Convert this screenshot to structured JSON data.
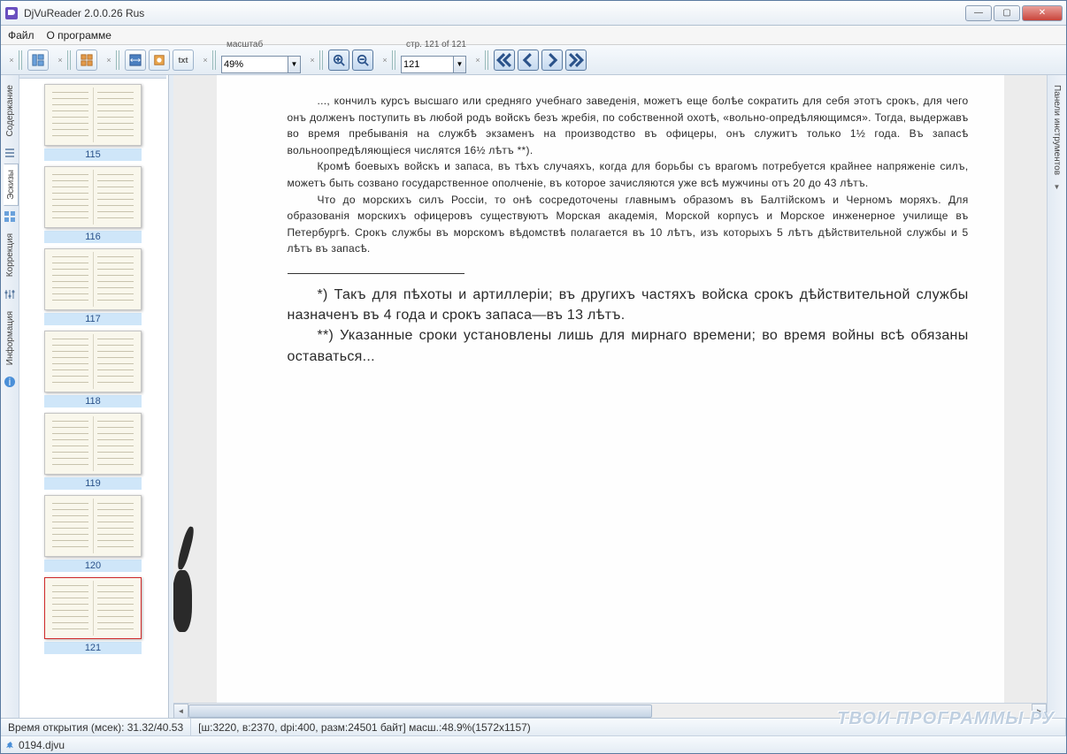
{
  "window": {
    "title": "DjVuReader 2.0.0.26 Rus"
  },
  "menu": {
    "file": "Файл",
    "about": "О программе"
  },
  "toolbar": {
    "scale_label": "масштаб",
    "scale_value": "49%",
    "page_label": "стр. 121 of 121",
    "page_value": "121"
  },
  "left_tabs": [
    "Содержание",
    "Эскизы",
    "Коррекция",
    "Информация"
  ],
  "left_active_index": 1,
  "thumbnails": [
    {
      "label": "115"
    },
    {
      "label": "116"
    },
    {
      "label": "117"
    },
    {
      "label": "118"
    },
    {
      "label": "119"
    },
    {
      "label": "120"
    },
    {
      "label": "121",
      "selected": true
    }
  ],
  "right_panel": {
    "label": "Панели инструментов"
  },
  "document": {
    "p1": "..., кончилъ курсъ высшаго или средняго учебнаго заведенія, можетъ еще болѣе сократить для себя этотъ срокъ, для чего онъ долженъ поступить въ любой родъ войскъ безъ жребія, по собственной охотѣ, «вольно-опредѣляющимся». Тогда, выдержавъ во время пребыванія на службѣ экзаменъ на производство въ офицеры, онъ служитъ только 1½ года. Въ запасѣ вольноопредѣляющіеся числятся 16½ лѣтъ **).",
    "p2": "Кромѣ боевыхъ войскъ и запаса, въ тѣхъ случаяхъ, когда для борьбы съ врагомъ потребуется крайнее напряженіе силъ, можетъ быть созвано государственное ополченіе, въ которое зачисляются уже всѣ мужчины отъ 20 до 43 лѣтъ.",
    "p3": "Что до морскихъ силъ Россіи, то онѣ сосредоточены главнымъ образомъ въ Балтійскомъ и Черномъ моряхъ. Для образованія морскихъ офицеровъ существуютъ Морская академія, Морской корпусъ и Морское инженерное училище въ Петербургѣ. Срокъ службы въ морскомъ вѣдомствѣ полагается въ 10 лѣтъ, изъ которыхъ 5 лѣтъ дѣйствительной службы и 5 лѣтъ въ запасѣ.",
    "f1": "*) Такъ для пѣхоты и артиллеріи; въ другихъ частяхъ войска срокъ дѣйствительной службы назначенъ въ 4 года и срокъ запаса—въ 13 лѣтъ.",
    "f2": "**) Указанные сроки установлены лишь для мирнаго времени; во время войны всѣ обязаны оставаться..."
  },
  "status": {
    "open_time": "Время открытия (мсек): 31.32/40.53",
    "page_info": "[ш:3220, в:2370, dpi:400, разм:24501 байт] масш.:48.9%(1572x1157)",
    "filename": "0194.djvu"
  },
  "watermark": "ТВОИ ПРОГРАММЫ РУ"
}
